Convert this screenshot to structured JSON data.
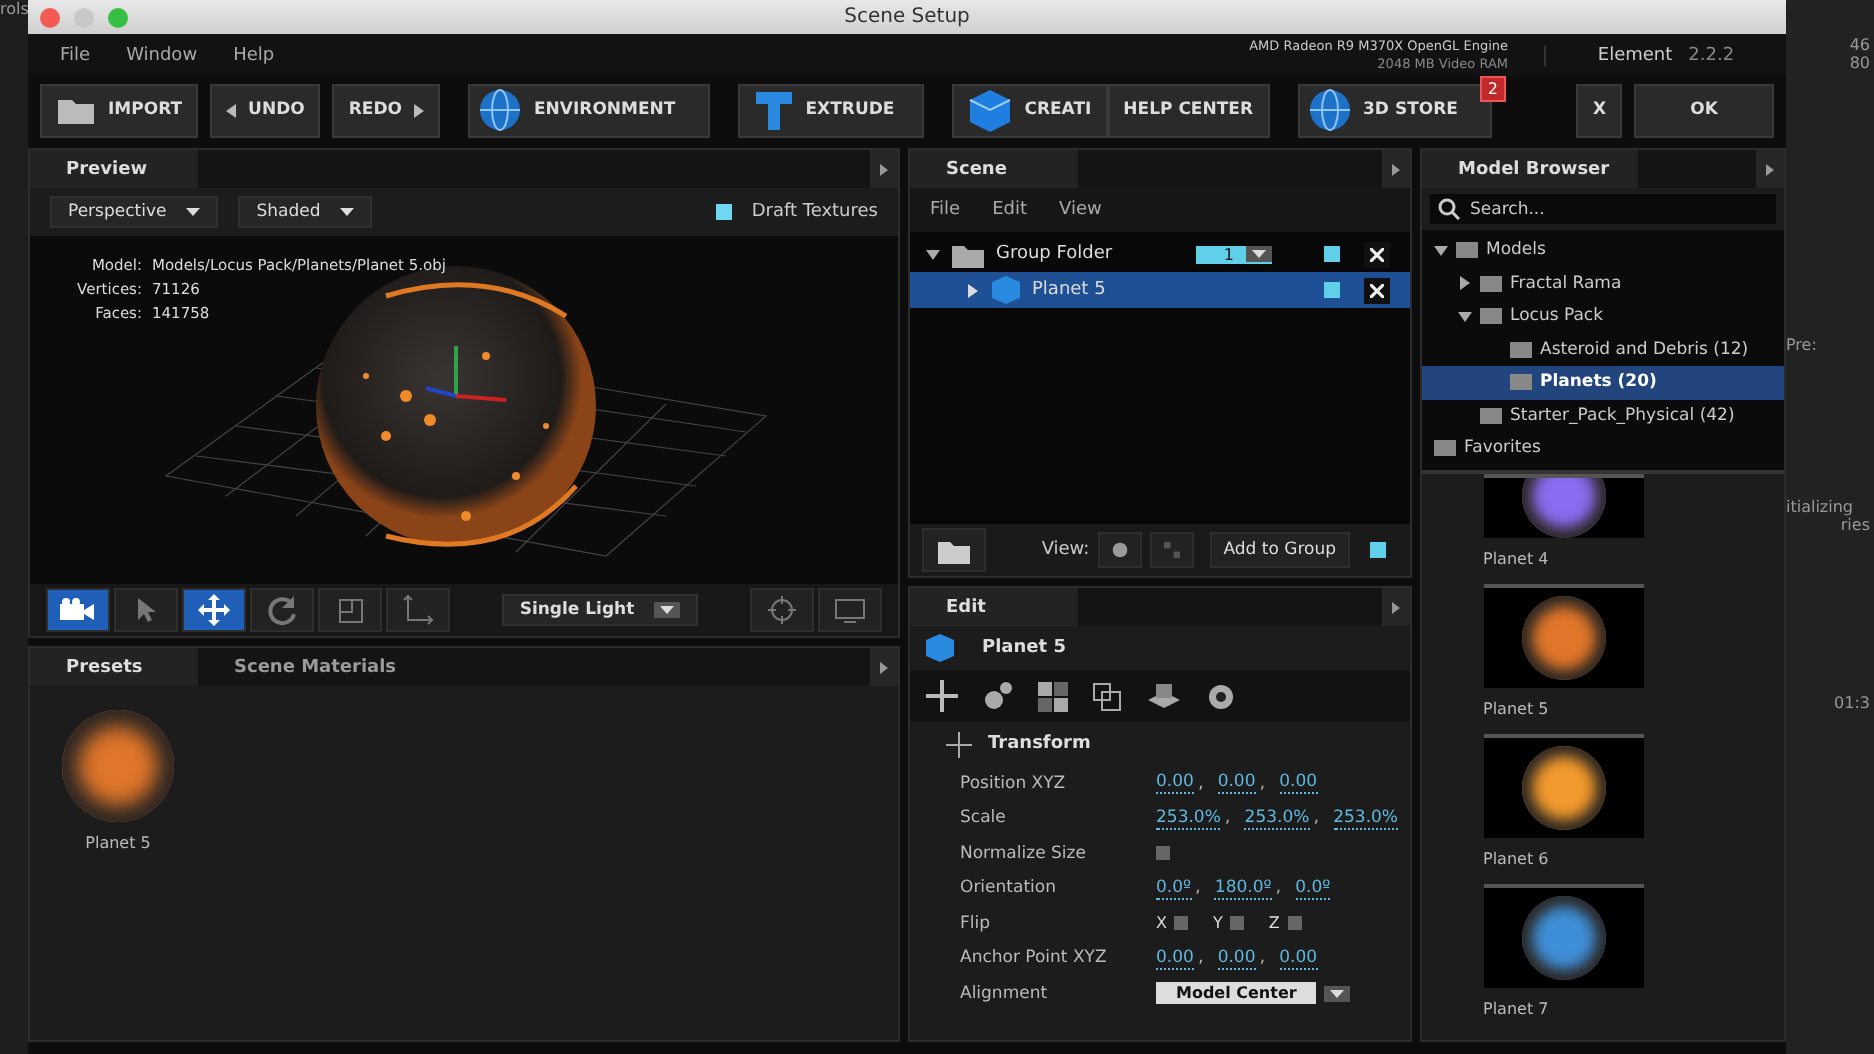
{
  "window": {
    "title": "Scene Setup"
  },
  "menu": [
    "File",
    "Window",
    "Help"
  ],
  "gpu_info": {
    "engine": "AMD Radeon R9 M370X OpenGL Engine",
    "vram": "2048 MB Video RAM"
  },
  "product": {
    "name": "Element",
    "version": "2.2.2"
  },
  "toolbar": [
    {
      "label": "IMPORT",
      "kind": "folder"
    },
    {
      "label": "UNDO",
      "kind": "undo"
    },
    {
      "label": "REDO",
      "kind": "redo"
    },
    {
      "label": "ENVIRONMENT",
      "kind": "globe"
    },
    {
      "label": "EXTRUDE",
      "kind": "extrude"
    },
    {
      "label": "CREATI",
      "kind": "cube"
    },
    {
      "label": "HELP CENTER",
      "kind": "plain"
    },
    {
      "label": "3D STORE",
      "kind": "globe",
      "badge": "2"
    }
  ],
  "dialog_buttons": [
    "X",
    "OK"
  ],
  "preview": {
    "title": "Preview",
    "view_mode": "Perspective",
    "shading": "Shaded",
    "draft_textures": {
      "label": "Draft Textures",
      "checked": true
    },
    "info": [
      {
        "label": "Model:",
        "value": "Models/Locus Pack/Planets/Planet 5.obj"
      },
      {
        "label": "Vertices:",
        "value": "71126"
      },
      {
        "label": "Faces:",
        "value": "141758"
      }
    ],
    "tools": [
      {
        "kind": "camera",
        "selected": true
      },
      {
        "kind": "pointer",
        "selected": false
      },
      {
        "kind": "move",
        "selected": true
      },
      {
        "kind": "rotate",
        "selected": false
      },
      {
        "kind": "scale",
        "selected": false
      },
      {
        "kind": "axis",
        "selected": false
      }
    ],
    "lighting": "Single Light"
  },
  "scene": {
    "title": "Scene",
    "menu": [
      "File",
      "Edit",
      "View"
    ],
    "tree": [
      {
        "name": "Group Folder",
        "kind": "folder",
        "expanded": true,
        "count": "1",
        "visible": true,
        "selected": false,
        "children": [
          {
            "name": "Planet 5",
            "kind": "model",
            "expanded": false,
            "visible": true,
            "selected": true
          }
        ]
      }
    ],
    "view_label": "View:",
    "add_to_group": {
      "label": "Add to Group",
      "checked": true
    }
  },
  "model_browser": {
    "title": "Model Browser",
    "search": {
      "placeholder": "Search..."
    },
    "tree": [
      {
        "name": "Models",
        "expanded": true,
        "selected": false,
        "children": [
          {
            "name": "Fractal Rama",
            "expanded": false,
            "selected": false
          },
          {
            "name": "Locus Pack",
            "expanded": true,
            "selected": false,
            "children": [
              {
                "name": "Asteroid and Debris (12)",
                "selected": false
              },
              {
                "name": "Planets (20)",
                "selected": true
              }
            ]
          },
          {
            "name": "Starter_Pack_Physical (42)",
            "selected": false
          }
        ]
      },
      {
        "name": "Favorites",
        "selected": false
      }
    ],
    "thumbnails": [
      {
        "name": "Planet 4",
        "color": "#8a6cf0"
      },
      {
        "name": "Planet 5",
        "color": "#e0762a"
      },
      {
        "name": "Planet 6",
        "color": "#f29a2e"
      },
      {
        "name": "Planet 7",
        "color": "#3f8fd8"
      }
    ]
  },
  "presets": {
    "tabs": [
      {
        "label": "Presets",
        "selected": true
      },
      {
        "label": "Scene Materials",
        "selected": false
      }
    ],
    "items": [
      {
        "name": "Planet 5",
        "color": "#e0762a"
      }
    ]
  },
  "edit": {
    "title": "Edit",
    "object": "Planet 5",
    "section": "Transform",
    "properties": [
      {
        "label": "Position XYZ",
        "kind": "values",
        "separator": ",",
        "values": [
          "0.00",
          "0.00",
          "0.00"
        ]
      },
      {
        "label": "Scale",
        "kind": "values",
        "separator": ",",
        "values": [
          "253.0%",
          "253.0%",
          "253.0%"
        ]
      },
      {
        "label": "Normalize Size",
        "kind": "checkbox",
        "checked": false
      },
      {
        "label": "Orientation",
        "kind": "values",
        "separator": ",",
        "values": [
          "0.0º",
          "180.0º",
          "0.0º"
        ]
      },
      {
        "label": "Flip",
        "kind": "flip",
        "axes": [
          {
            "label": "X",
            "checked": false
          },
          {
            "label": "Y",
            "checked": false
          },
          {
            "label": "Z",
            "checked": false
          }
        ]
      },
      {
        "label": "Anchor Point XYZ",
        "kind": "values",
        "separator": ",",
        "values": [
          "0.00",
          "0.00",
          "0.00"
        ]
      },
      {
        "label": "Alignment",
        "kind": "dropdown",
        "value": "Model Center"
      }
    ]
  },
  "background_app": {
    "corner_text": "rols",
    "numbers": [
      "46",
      "80"
    ],
    "panel_label": "Pre:",
    "status": [
      "itializing",
      "ries"
    ],
    "timecode": "01:3"
  }
}
